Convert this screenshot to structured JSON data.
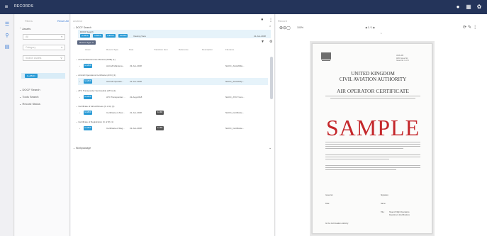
{
  "app": {
    "title": "RECORDS"
  },
  "topbar": {
    "icons": [
      "bell-icon",
      "grid-icon",
      "settings-icon"
    ]
  },
  "filters": {
    "title": "Filters",
    "reset_label": "Reset All",
    "assets_label": "Assets",
    "all_value": "All",
    "category_placeholder": "Category",
    "search_placeholder": "Search Assets",
    "selected_asset": "G-ABCD",
    "sections": [
      "DOCF Search",
      "Tools Search",
      "Record Status"
    ]
  },
  "results": {
    "title": "Archive",
    "saved_label": "DOCF Search",
    "query": {
      "label": "DOCF Search",
      "tags": [
        "G-ABCD",
        "G-BBCD",
        "G-EFGH",
        "AIR-B00"
      ],
      "text": "Viewing View",
      "date": "21-Jun-2018"
    },
    "filter_chip": "Record Type",
    "columns": [
      "Asset",
      "Record Type",
      "Date",
      "Transition Item",
      "Reference",
      "Description",
      "Filename"
    ],
    "groups": [
      {
        "title": "Aircraft Maintenance Manual (AMM) (1)",
        "rows": [
          {
            "asset": "G-ABCD",
            "type": "Aircraft Maintena...",
            "date": "23-Jun-2018",
            "badge": "",
            "file": "NAOC_AircraftMa..."
          }
        ]
      },
      {
        "title": "Aircraft Operations Certificate (AOC) (1)",
        "rows": [
          {
            "asset": "G-ABCD",
            "type": "Aircraft Operatio...",
            "date": "21-Jun-2018",
            "badge": "",
            "file": "NAOC_AircraftOp..."
          }
        ]
      },
      {
        "title": "ATC Transponder Serviceable (ATC) (1)",
        "rows": [
          {
            "asset": "G-ABCD",
            "type": "ATC Transponder ...",
            "date": "21-Aug-2018",
            "badge": "",
            "file": "NAOC_ATC Trans..."
          }
        ]
      },
      {
        "title": "Certificate of Airworthiness (C of A) (1)",
        "rows": [
          {
            "asset": "G-ABCD",
            "type": "Certificate of Airw...",
            "date": "21-Jun-2018",
            "badge": "G-JIMI",
            "file": "NAOC_Certificate..."
          }
        ]
      },
      {
        "title": "Certificate of Registration (C of R) (1)",
        "rows": [
          {
            "asset": "G-ABCD",
            "type": "Certificate of Reg...",
            "date": "21-Jun-2018",
            "badge": "G-JIMI",
            "file": "NAOC_Certificate..."
          }
        ]
      }
    ],
    "more_label": "Workpackage"
  },
  "viewer": {
    "title": "Record",
    "zoom": "100%",
    "pager": "◀  1 / 1  ▶",
    "page": "1",
    "doc": {
      "ref": [
        "UK/F-AB",
        "AOC Issue No:",
        "Issue No: 1 of 4"
      ],
      "line1": "UNITED KINGDOM",
      "line2": "CIVIL AVIATION AUTHORITY",
      "line3": "AIR OPERATOR CERTIFICATE",
      "watermark": "SAMPLE",
      "issued_at": "Issued at:",
      "date": "Date:",
      "signature": "Signature:",
      "name": "Name:",
      "title_label": "Title:",
      "title_value": "Head of Flight Operations",
      "title_value2": "Department (Certification)",
      "authority": "for the Civil Aviation Authority"
    }
  }
}
